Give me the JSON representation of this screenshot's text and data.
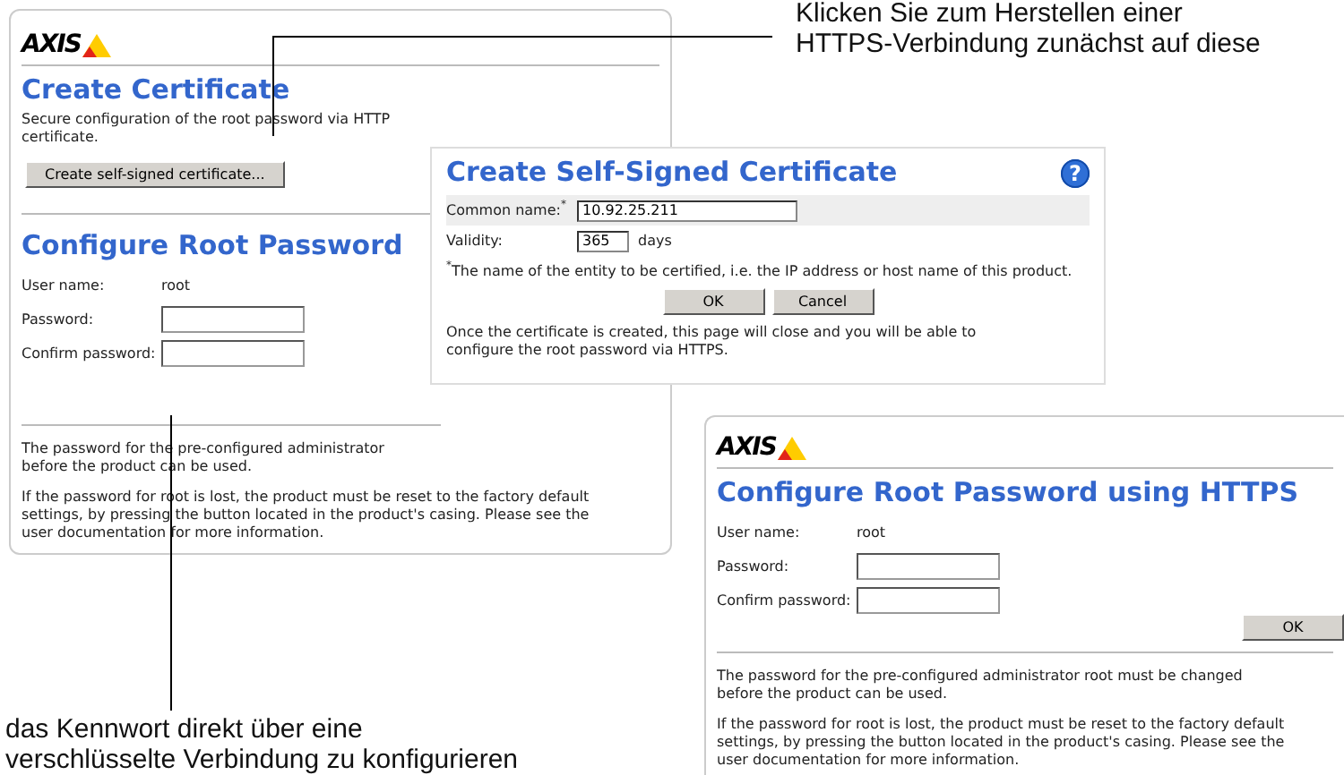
{
  "certificate_window": {
    "logo": "AXIS",
    "title": "Create Certificate",
    "description_lines": [
      "Secure configuration of the root password via HTTP",
      "certificate."
    ],
    "button": "Create self-signed certificate...",
    "password_title": "Configure Root Password",
    "fields": [
      {
        "kind": "text",
        "label": "User name:",
        "value": "root"
      },
      {
        "kind": "input",
        "label": "Password:"
      },
      {
        "kind": "input",
        "label": "Confirm password:"
      }
    ],
    "notes": [
      [
        "The password for the pre-configured administrator",
        "before the product can be used."
      ],
      [
        "If the password for root is lost, the product must be reset to the factory default",
        "settings, by pressing the button located in the product's casing. Please see the",
        "user documentation for more information."
      ]
    ]
  },
  "certificate_dialog": {
    "title": "Create Self-Signed Certificate",
    "help": "?",
    "common_name_label": "Common name:$^{*}$",
    "common_name": "10.92.25.211",
    "validity_label": "Validity:",
    "validity": "365",
    "validity_unit": "days",
    "footnote": "$^{*}$The name of the entity to be certified, i.e. the IP address or host name of this product.",
    "buttons": [
      "OK",
      "Cancel"
    ],
    "note": "Once the certificate is created, this page will close and you will be able to configure the root password via HTTPS."
  },
  "https_window": {
    "logo": "AXIS",
    "title": "Configure Root Password using HTTPS",
    "fields": [
      {
        "kind": "text",
        "label": "User name:",
        "value": "root"
      },
      {
        "kind": "input",
        "label": "Password:"
      },
      {
        "kind": "input",
        "label": "Confirm password:"
      }
    ],
    "button": "OK",
    "notes": [
      [
        "The password for the pre-configured administrator root must be changed",
        "before the product can be used."
      ],
      [
        "If the password for root is lost, the product must be reset to the factory default",
        "settings, by pressing the button located in the product's casing. Please see the",
        "user documentation for more information."
      ]
    ]
  },
  "callouts": [
    {
      "lines": [
        "Klicken Sie zum Herstellen einer",
        "HTTPS-Verbindung zunächst auf diese"
      ]
    },
    {
      "lines": [
        "das Kennwort direkt über eine",
        "verschlüsselte Verbindung zu konfigurieren"
      ]
    }
  ]
}
